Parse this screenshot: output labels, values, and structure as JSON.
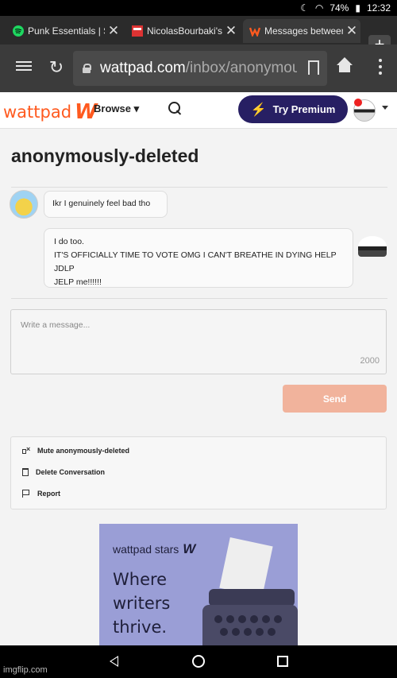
{
  "status": {
    "battery": "74%",
    "time": "12:32"
  },
  "tabs": [
    {
      "title": "Punk Essentials | S",
      "favicon": "spotify-icon"
    },
    {
      "title": "NicolasBourbaki's",
      "favicon": "tumblr-icon"
    },
    {
      "title": "Messages between",
      "favicon": "wattpad-icon"
    }
  ],
  "omnibar": {
    "url_host": "wattpad.com",
    "url_path": "/inbox/anonymou"
  },
  "header": {
    "logo_text": "wattpad",
    "logo_mark": "W",
    "browse_label": "Browse",
    "premium_label": "Try Premium"
  },
  "conversation": {
    "title": "anonymously-deleted",
    "messages": [
      {
        "text": "Ikr I genuinely feel bad tho"
      },
      {
        "lines": [
          "I do too.",
          "IT'S OFFICIALLY TIME TO VOTE OMG I CAN'T BREATHE IN DYING HELP JDLP",
          "JELP me!!!!!!"
        ]
      }
    ]
  },
  "composer": {
    "placeholder": "Write a message...",
    "char_count": "2000",
    "send_label": "Send"
  },
  "actions": [
    {
      "label": "Mute anonymously-deleted",
      "icon": "mute-icon"
    },
    {
      "label": "Delete Conversation",
      "icon": "trash-icon"
    },
    {
      "label": "Report",
      "icon": "flag-icon"
    }
  ],
  "ad": {
    "brand": "wattpad stars",
    "brand_mark": "W",
    "headline": [
      "Where",
      "writers",
      "thrive."
    ]
  },
  "watermark": "imgflip.com",
  "colors": {
    "brand": "#ff5a1f",
    "premium_bg": "#271f63",
    "send_bg": "#f1b39c",
    "ad_bg": "#9a9ed6"
  }
}
